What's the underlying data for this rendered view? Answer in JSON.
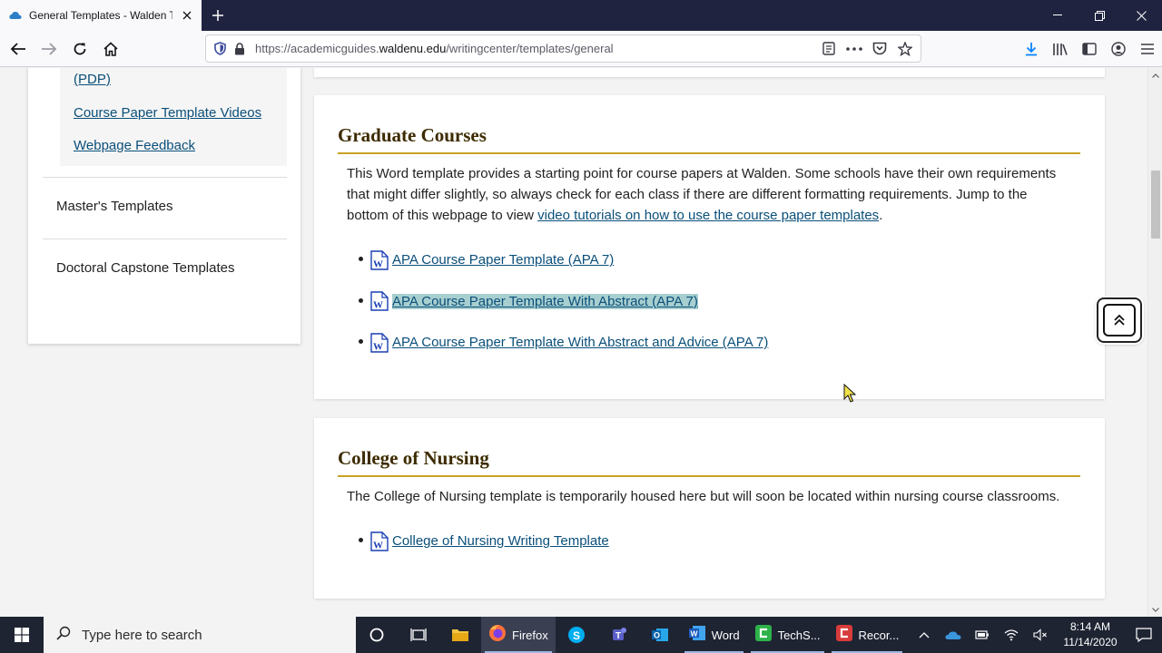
{
  "browser": {
    "tab_title": "General Templates - Walden Te",
    "url_prefix": "https://academicguides.",
    "url_host": "waldenu.edu",
    "url_path": "/writingcenter/templates/general"
  },
  "sidebar": {
    "sublinks": [
      "(PDP)",
      "Course Paper Template Videos",
      "Webpage Feedback"
    ],
    "items": [
      "Master's Templates",
      "Doctoral Capstone Templates"
    ]
  },
  "graduate": {
    "heading": "Graduate Courses",
    "text_line1": "This Word template provides a starting point for course papers at Walden. Some schools have their own requirements",
    "text_line2": "that might differ slightly, so always check for each class if there are different formatting requirements. Jump to the",
    "text_line3_prefix": "bottom of this webpage to view ",
    "text_link": "video tutorials on how to use the course paper templates",
    "text_line3_suffix": ".",
    "docs": [
      "APA Course Paper Template (APA 7)",
      "APA Course Paper Template With Abstract (APA 7)",
      "APA Course Paper Template With Abstract and Advice (APA 7)"
    ]
  },
  "nursing": {
    "heading": "College of Nursing",
    "text": "The College of Nursing template is temporarily housed here but will soon be located within nursing course classrooms.",
    "docs": [
      "College of Nursing Writing Template"
    ]
  },
  "taskbar": {
    "search_placeholder": "Type here to search",
    "apps": [
      "Firefox",
      "Word",
      "TechS...",
      "Recor..."
    ],
    "time": "8:14 AM",
    "date": "11/14/2020"
  },
  "colors": {
    "link": "#0a4f7a",
    "heading": "#3d2b00",
    "rule": "#c9a227",
    "highlight": "#a8cfd0"
  },
  "icons": [
    "firefox-icon",
    "word-doc-icon",
    "scroll-to-top-icon",
    "search-icon",
    "windows-start-icon"
  ]
}
